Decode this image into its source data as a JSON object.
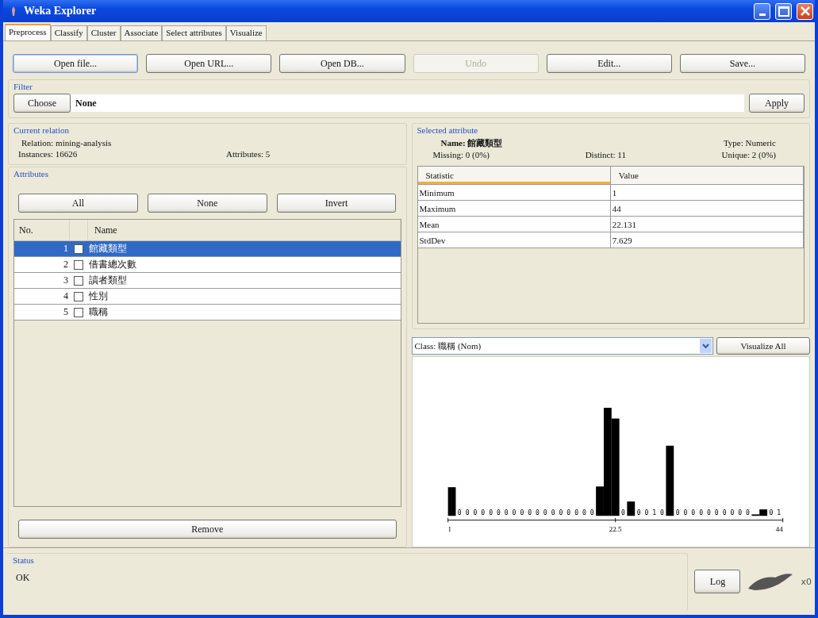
{
  "window": {
    "title": "Weka Explorer"
  },
  "tabs": [
    {
      "label": "Preprocess",
      "selected": true
    },
    {
      "label": "Classify",
      "selected": false
    },
    {
      "label": "Cluster",
      "selected": false
    },
    {
      "label": "Associate",
      "selected": false
    },
    {
      "label": "Select attributes",
      "selected": false
    },
    {
      "label": "Visualize",
      "selected": false
    }
  ],
  "toolbar": [
    {
      "label": "Open file...",
      "disabled": false,
      "focused": true
    },
    {
      "label": "Open URL...",
      "disabled": false,
      "focused": false
    },
    {
      "label": "Open DB...",
      "disabled": false,
      "focused": false
    },
    {
      "label": "Undo",
      "disabled": true,
      "focused": false
    },
    {
      "label": "Edit...",
      "disabled": false,
      "focused": false
    },
    {
      "label": "Save...",
      "disabled": false,
      "focused": false
    }
  ],
  "filter": {
    "title": "Filter",
    "choose": "Choose",
    "value": "None",
    "apply": "Apply"
  },
  "current_relation": {
    "title": "Current relation",
    "relation": "Relation: mining-analysis",
    "instances": "Instances: 16626",
    "attributes": "Attributes: 5"
  },
  "attributes": {
    "title": "Attributes",
    "buttons": [
      "All",
      "None",
      "Invert"
    ],
    "columns": [
      "No.",
      "Name"
    ],
    "rows": [
      {
        "no": "1",
        "name": "館藏類型",
        "checked": false,
        "selected": true
      },
      {
        "no": "2",
        "name": "借書總次數",
        "checked": false,
        "selected": false
      },
      {
        "no": "3",
        "name": "讀者類型",
        "checked": false,
        "selected": false
      },
      {
        "no": "4",
        "name": "性別",
        "checked": false,
        "selected": false
      },
      {
        "no": "5",
        "name": "職稱",
        "checked": false,
        "selected": false
      }
    ],
    "remove": "Remove"
  },
  "selected_attribute": {
    "title": "Selected attribute",
    "name": "Name: 館藏類型",
    "type": "Type: Numeric",
    "missing": "Missing: 0 (0%)",
    "distinct": "Distinct: 11",
    "unique": "Unique: 2 (0%)",
    "columns": [
      "Statistic",
      "Value"
    ],
    "rows": [
      [
        "Minimum",
        "1"
      ],
      [
        "Maximum",
        "44"
      ],
      [
        "Mean",
        "22.131"
      ],
      [
        "StdDev",
        "7.629"
      ]
    ]
  },
  "class_selector": {
    "value": "Class: 職稱 (Nom)",
    "visualize_all": "Visualize All"
  },
  "histogram": {
    "axis_labels": [
      "1",
      "22.5",
      "44"
    ],
    "bins": [
      {
        "kind": "bar"
      },
      {
        "kind": "count",
        "label": "0"
      },
      {
        "kind": "count",
        "label": "0"
      },
      {
        "kind": "count",
        "label": "0"
      },
      {
        "kind": "count",
        "label": "0"
      },
      {
        "kind": "count",
        "label": "0"
      },
      {
        "kind": "count",
        "label": "0"
      },
      {
        "kind": "count",
        "label": "0"
      },
      {
        "kind": "count",
        "label": "0"
      },
      {
        "kind": "count",
        "label": "0"
      },
      {
        "kind": "count",
        "label": "0"
      },
      {
        "kind": "count",
        "label": "0"
      },
      {
        "kind": "count",
        "label": "0"
      },
      {
        "kind": "count",
        "label": "0"
      },
      {
        "kind": "count",
        "label": "0"
      },
      {
        "kind": "count",
        "label": "0"
      },
      {
        "kind": "count",
        "label": "0"
      },
      {
        "kind": "count",
        "label": "0"
      },
      {
        "kind": "count",
        "label": "0"
      },
      {
        "kind": "bar"
      },
      {
        "kind": "bar"
      },
      {
        "kind": "bar"
      },
      {
        "kind": "count",
        "label": "0"
      },
      {
        "kind": "bar"
      },
      {
        "kind": "count",
        "label": "0"
      },
      {
        "kind": "count",
        "label": "0"
      },
      {
        "kind": "count",
        "label": "1"
      },
      {
        "kind": "count",
        "label": "0"
      },
      {
        "kind": "bar"
      },
      {
        "kind": "count",
        "label": "0"
      },
      {
        "kind": "count",
        "label": "0"
      },
      {
        "kind": "count",
        "label": "0"
      },
      {
        "kind": "count",
        "label": "0"
      },
      {
        "kind": "count",
        "label": "0"
      },
      {
        "kind": "count",
        "label": "0"
      },
      {
        "kind": "count",
        "label": "0"
      },
      {
        "kind": "count",
        "label": "0"
      },
      {
        "kind": "count",
        "label": "0"
      },
      {
        "kind": "count",
        "label": "0"
      },
      {
        "kind": "bar"
      },
      {
        "kind": "bar"
      },
      {
        "kind": "count",
        "label": "0"
      },
      {
        "kind": "count",
        "label": "1"
      }
    ]
  },
  "status": {
    "title": "Status",
    "message": "OK",
    "log": "Log",
    "count": "x0"
  }
}
